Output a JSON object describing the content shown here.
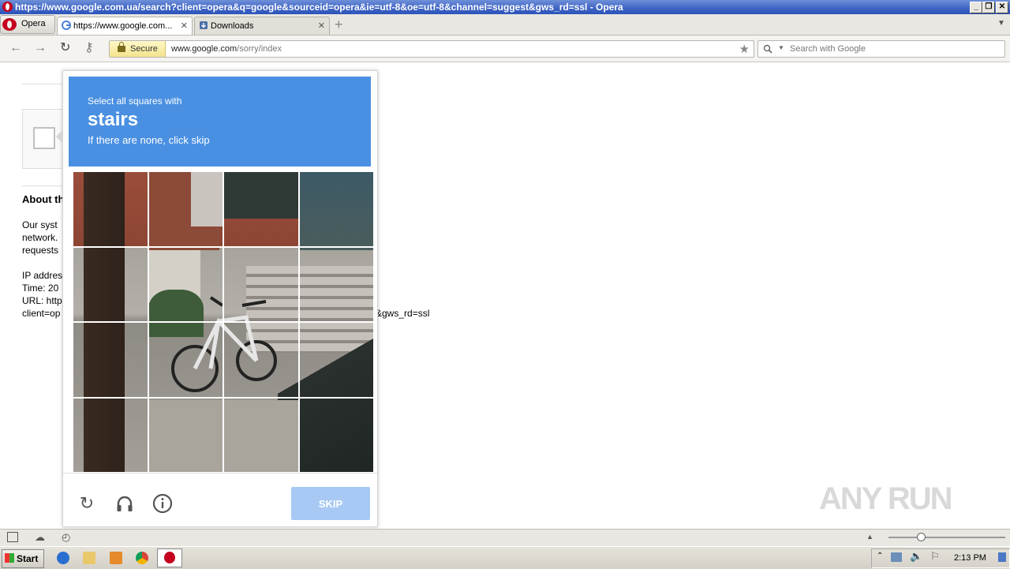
{
  "window": {
    "title": "https://www.google.com.ua/search?client=opera&q=google&sourceid=opera&ie=utf-8&oe=utf-8&channel=suggest&gws_rd=ssl - Opera"
  },
  "tabs": {
    "menu_label": "Opera",
    "items": [
      {
        "label": "https://www.google.com..."
      },
      {
        "label": "Downloads"
      }
    ],
    "new_tab": "+"
  },
  "address": {
    "secure_label": "Secure",
    "url_domain": "www.google.com",
    "url_path": "/sorry/index",
    "search_placeholder": "Search with Google"
  },
  "page": {
    "about_heading": "About th",
    "lines": [
      "Our syst",
      "network.",
      "requests"
    ],
    "ip_line": "IP addres",
    "time_line": "Time: 20",
    "url_line": "URL: http",
    "client_line": "client=op",
    "url_tail": "&gws_rd=ssl"
  },
  "captcha": {
    "instruction": "Select all squares with",
    "target": "stairs",
    "hint": "If there are none, click skip",
    "skip_label": "SKIP",
    "grid_size": 4
  },
  "taskbar": {
    "start_label": "Start",
    "clock": "2:13 PM"
  },
  "watermark": "ANY RUN"
}
